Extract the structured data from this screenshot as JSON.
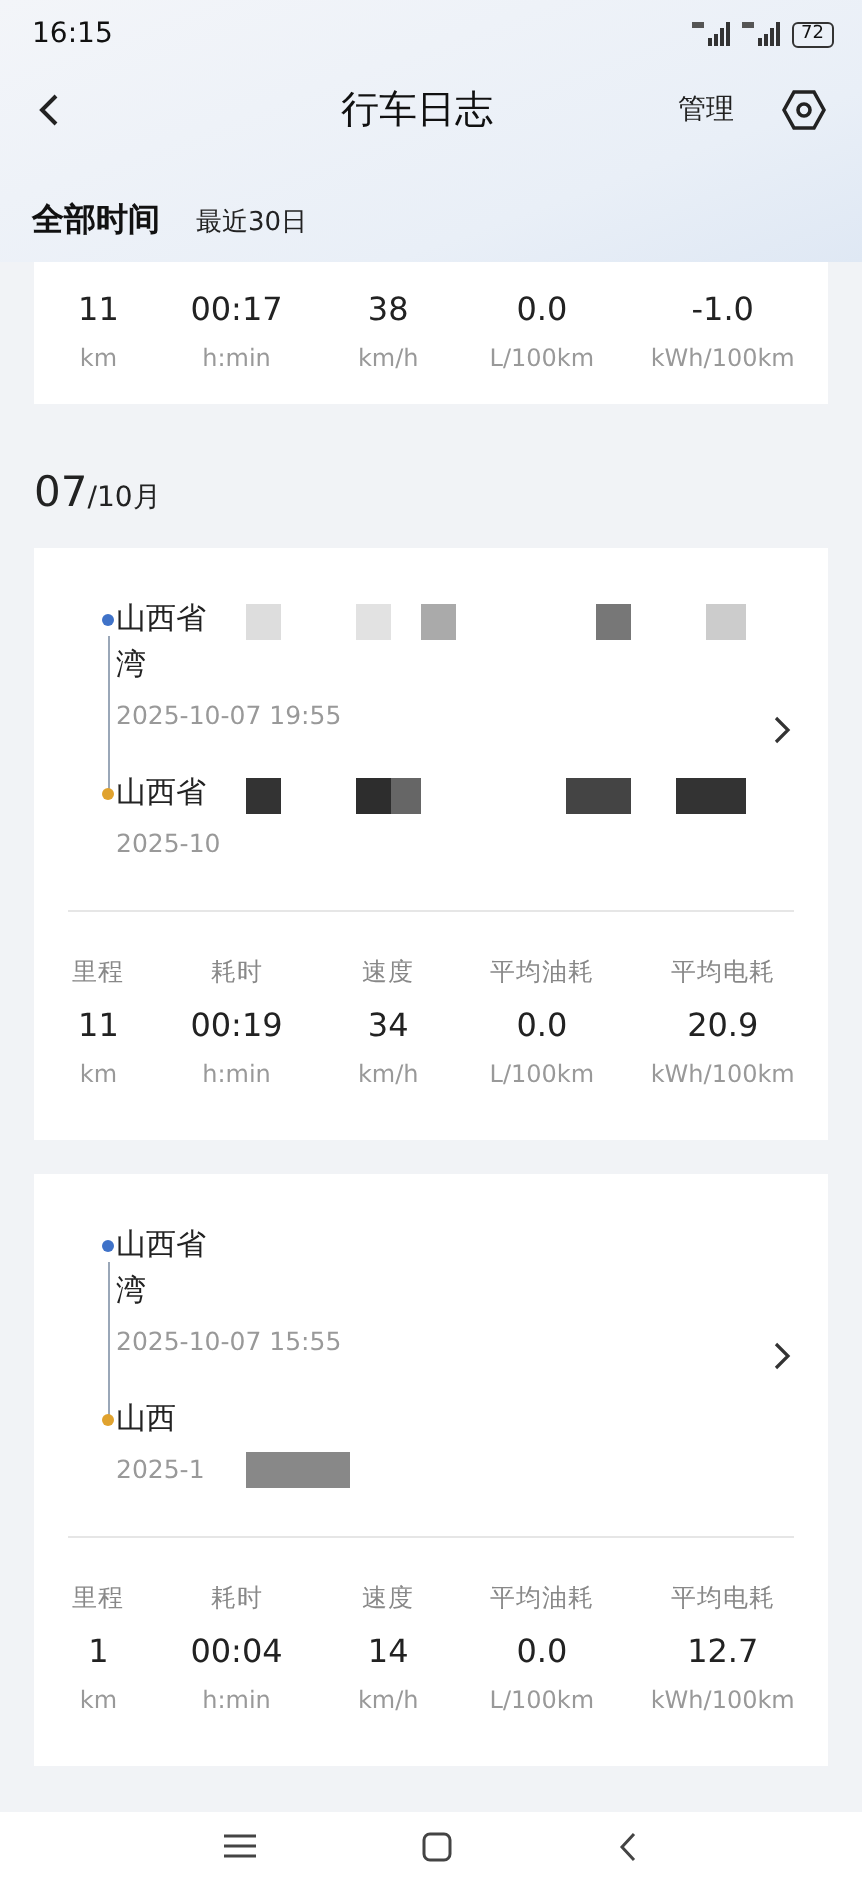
{
  "status_bar": {
    "time": "16:15",
    "battery": "72"
  },
  "header": {
    "title": "行车日志",
    "action": "管理"
  },
  "range_tabs": [
    {
      "label": "全部时间",
      "selected": true
    },
    {
      "label": "最近30日",
      "selected": false
    }
  ],
  "summary": [
    {
      "value": "11",
      "unit": "km"
    },
    {
      "value": "00:17",
      "unit": "h:min"
    },
    {
      "value": "38",
      "unit": "km/h"
    },
    {
      "value": "0.0",
      "unit": "L/100km"
    },
    {
      "value": "-1.0",
      "unit": "kWh/100km"
    }
  ],
  "date_header": {
    "day": "07",
    "month": "/10月"
  },
  "trips": [
    {
      "start": {
        "lines": [
          "山西省",
          "湾"
        ],
        "time": "2025-10-07 19:55",
        "redacted": true
      },
      "end": {
        "lines": [
          "山西省"
        ],
        "time": "2025-10",
        "redacted": true
      },
      "stats": [
        {
          "label": "里程",
          "value": "11",
          "unit": "km"
        },
        {
          "label": "耗时",
          "value": "00:19",
          "unit": "h:min"
        },
        {
          "label": "速度",
          "value": "34",
          "unit": "km/h"
        },
        {
          "label": "平均油耗",
          "value": "0.0",
          "unit": "L/100km"
        },
        {
          "label": "平均电耗",
          "value": "20.9",
          "unit": "kWh/100km"
        }
      ]
    },
    {
      "start": {
        "lines": [
          "山西省",
          "湾"
        ],
        "time": "2025-10-07 15:55",
        "redacted": false
      },
      "end": {
        "lines": [
          "山西"
        ],
        "time": "2025-1",
        "redacted": true
      },
      "stats": [
        {
          "label": "里程",
          "value": "1",
          "unit": "km"
        },
        {
          "label": "耗时",
          "value": "00:04",
          "unit": "h:min"
        },
        {
          "label": "速度",
          "value": "14",
          "unit": "km/h"
        },
        {
          "label": "平均油耗",
          "value": "0.0",
          "unit": "L/100km"
        },
        {
          "label": "平均电耗",
          "value": "12.7",
          "unit": "kWh/100km"
        }
      ]
    }
  ]
}
